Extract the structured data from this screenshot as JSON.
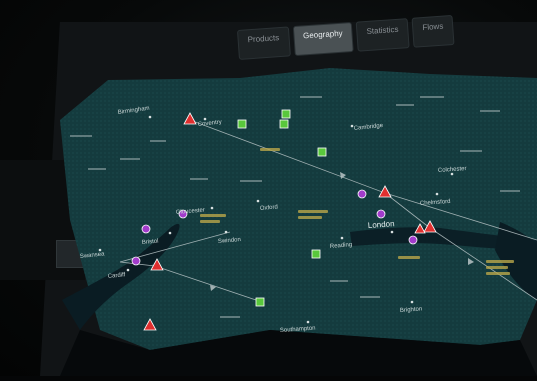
{
  "tabs": [
    {
      "label": "Products",
      "active": false
    },
    {
      "label": "Geography",
      "active": true
    },
    {
      "label": "Statistics",
      "active": false
    },
    {
      "label": "Flows",
      "active": false
    }
  ],
  "map": {
    "cities": [
      {
        "name": "Birmingham"
      },
      {
        "name": "Coventry"
      },
      {
        "name": "Cambridge"
      },
      {
        "name": "Oxford"
      },
      {
        "name": "Gloucester"
      },
      {
        "name": "Swindon"
      },
      {
        "name": "Bristol"
      },
      {
        "name": "Reading"
      },
      {
        "name": "London"
      },
      {
        "name": "Colchester"
      },
      {
        "name": "Chelmsford"
      },
      {
        "name": "Southampton"
      },
      {
        "name": "Brighton"
      },
      {
        "name": "Cardiff"
      },
      {
        "name": "Swansea"
      }
    ],
    "colors": {
      "land": "#133a3d",
      "water": "#0a1c23",
      "route": "#b8c4c6",
      "triangle_marker": "#e02f2f",
      "square_marker": "#59c83c",
      "circle_marker": "#a23ccb",
      "label": "#c9d6d6",
      "region_label": "#b8a64a"
    },
    "marker_types": [
      "red-triangle",
      "green-square",
      "purple-circle"
    ]
  }
}
